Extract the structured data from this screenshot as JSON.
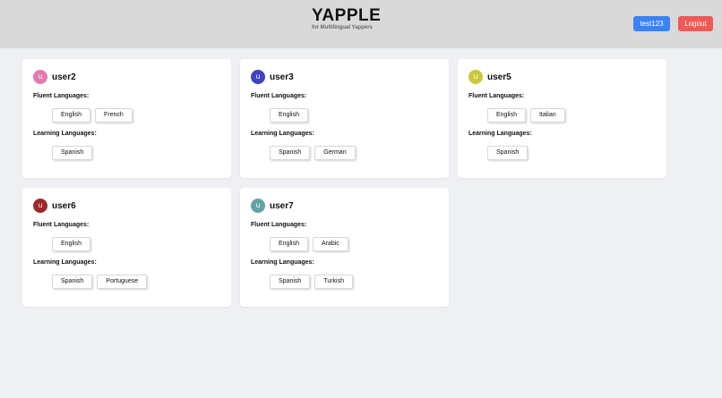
{
  "header": {
    "title": "YAPPLE",
    "subtitle": "for Multilingual Yappers",
    "user_button": "test123",
    "logout_button": "Logout"
  },
  "labels": {
    "fluent": "Fluent Languages:",
    "learning": "Learning Languages:"
  },
  "users": [
    {
      "initial": "u",
      "name": "user2",
      "color": "#e27bb0",
      "fluent": [
        "English",
        "French"
      ],
      "learning": [
        "Spanish"
      ]
    },
    {
      "initial": "u",
      "name": "user3",
      "color": "#3f44c2",
      "fluent": [
        "English"
      ],
      "learning": [
        "Spanish",
        "German"
      ]
    },
    {
      "initial": "u",
      "name": "user5",
      "color": "#c9c93a",
      "fluent": [
        "English",
        "Italian"
      ],
      "learning": [
        "Spanish"
      ]
    },
    {
      "initial": "u",
      "name": "user6",
      "color": "#9b2a2a",
      "fluent": [
        "English"
      ],
      "learning": [
        "Spanish",
        "Portuguese"
      ]
    },
    {
      "initial": "u",
      "name": "user7",
      "color": "#62a3a6",
      "fluent": [
        "English",
        "Arabic"
      ],
      "learning": [
        "Spanish",
        "Turkish"
      ]
    }
  ]
}
